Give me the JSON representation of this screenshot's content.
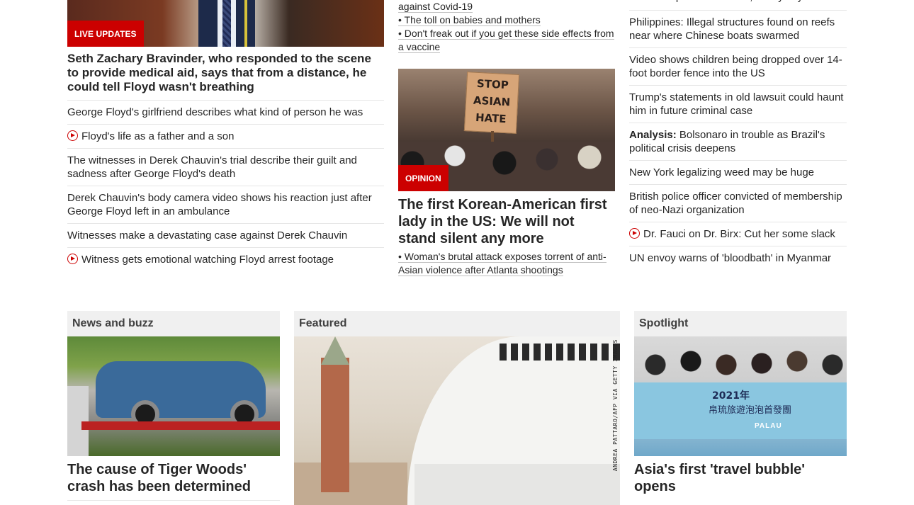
{
  "col1": {
    "badge": "LIVE UPDATES",
    "headline": "Seth Zachary Bravinder, who responded to the scene to provide medical aid, says that from a distance, he could tell Floyd wasn't breathing",
    "items": [
      {
        "text": "George Floyd's girlfriend describes what kind of person he was",
        "video": false
      },
      {
        "text": "Floyd's life as a father and a son",
        "video": true
      },
      {
        "text": "The witnesses in Derek Chauvin's trial describe their guilt and sadness after George Floyd's death",
        "video": false
      },
      {
        "text": "Derek Chauvin's body camera video shows his reaction just after George Floyd left in an ambulance",
        "video": false
      },
      {
        "text": "Witnesses make a devastating case against Derek Chauvin",
        "video": false
      },
      {
        "text": "Witness gets emotional watching Floyd arrest footage",
        "video": true
      }
    ]
  },
  "col2": {
    "related_top": [
      "against Covid-19",
      "• The toll on babies and mothers",
      "• Don't freak out if you get these side effects from a vaccine"
    ],
    "sign_lines": [
      "STOP",
      "ASIAN",
      "HATE"
    ],
    "badge": "OPINION",
    "headline": "The first Korean-American first lady in the US: We will not stand silent any more",
    "sub": "• Woman's brutal attack exposes torrent of anti-Asian violence after Atlanta shootings"
  },
  "col3": {
    "items": [
      {
        "prefix": "",
        "text": "Mozambique terror attack, family says"
      },
      {
        "prefix": "",
        "text": "Philippines: Illegal structures found on reefs near where Chinese boats swarmed"
      },
      {
        "prefix": "",
        "text": "Video shows children being dropped over 14-foot border fence into the US"
      },
      {
        "prefix": "",
        "text": "Trump's statements in old lawsuit could haunt him in future criminal case"
      },
      {
        "prefix": "Analysis:",
        "text": " Bolsonaro in trouble as Brazil's political crisis deepens"
      },
      {
        "prefix": "",
        "text": "New York legalizing weed may be huge"
      },
      {
        "prefix": "",
        "text": "British police officer convicted of membership of neo-Nazi organization"
      },
      {
        "prefix": "",
        "text": "Dr. Fauci on Dr. Birx: Cut her some slack",
        "video": true
      },
      {
        "prefix": "",
        "text": "UN envoy warns of 'bloodbath' in Myanmar"
      }
    ]
  },
  "zones": {
    "news": {
      "title": "News and buzz",
      "headline": "The cause of Tiger Woods' crash has been determined"
    },
    "featured": {
      "title": "Featured",
      "credit": "ANDREA PATTARO/AFP VIA GETTY IMAGES"
    },
    "spotlight": {
      "title": "Spotlight",
      "headline": "Asia's first 'travel bubble' opens",
      "banner_year": "2021年",
      "banner_text": "帛琉旅遊泡泡首發團",
      "banner_palau": "PALAU"
    }
  }
}
